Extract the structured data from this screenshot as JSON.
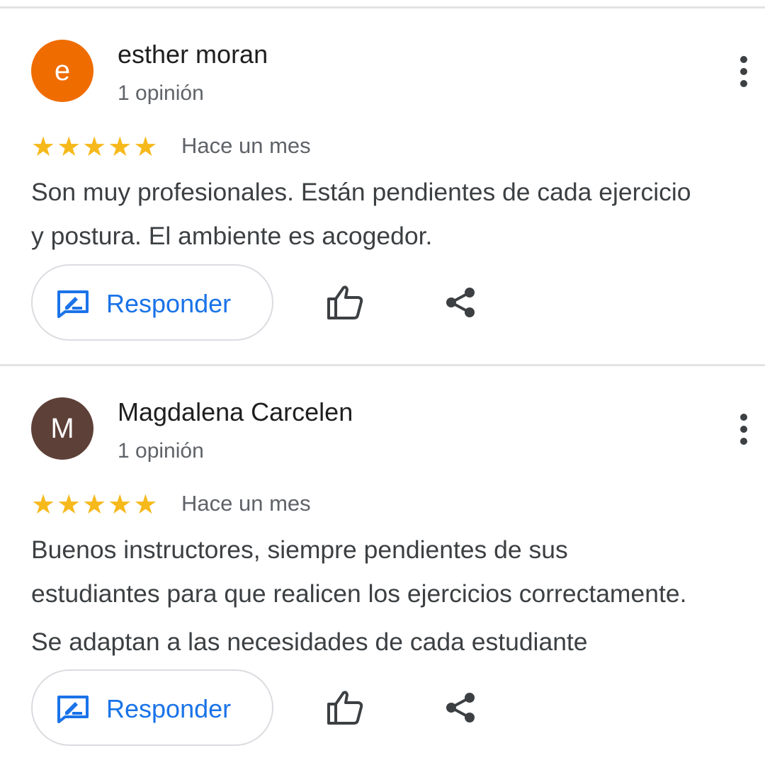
{
  "reviews": [
    {
      "avatar_letter": "e",
      "avatar_color": "#ef6c00",
      "author": "esther moran",
      "review_count": "1 opinión",
      "rating": 5,
      "date": "Hace un mes",
      "text_lines": [
        "Son muy profesionales. Están pendientes de cada ejercicio",
        "y postura. El ambiente es acogedor."
      ],
      "reply_label": "Responder"
    },
    {
      "avatar_letter": "M",
      "avatar_color": "#5d4037",
      "author": "Magdalena Carcelen",
      "review_count": "1 opinión",
      "rating": 5,
      "date": "Hace un mes",
      "text_lines": [
        "Buenos instructores, siempre pendientes de sus",
        "estudiantes para que realicen los ejercicios correctamente.",
        "Se adaptan a las necesidades de cada estudiante"
      ],
      "reply_label": "Responder"
    }
  ],
  "icons": {
    "more": "more-vert-icon",
    "reply": "rate-review-icon",
    "like": "thumb-up-icon",
    "share": "share-icon"
  },
  "colors": {
    "accent": "#1a73e8",
    "star": "#f6b91c",
    "secondary_text": "#5f6368"
  }
}
